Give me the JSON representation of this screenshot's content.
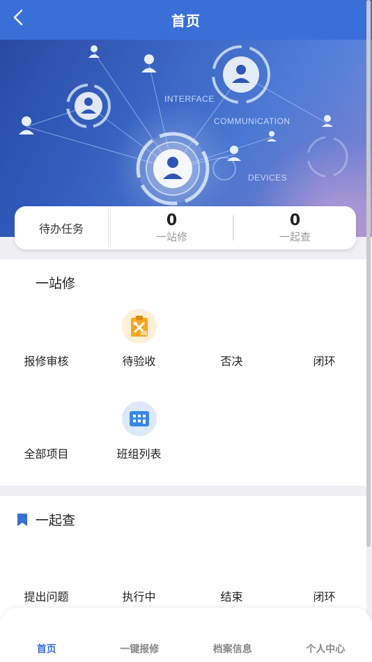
{
  "header": {
    "title": "首页"
  },
  "banner": {
    "text_interface": "INTERFACE",
    "text_communication": "COMMUNICATION",
    "text_devices": "DEVICES"
  },
  "tasks": {
    "label": "待办任务",
    "stats": [
      {
        "value": "0",
        "label": "一站修"
      },
      {
        "value": "0",
        "label": "一起查"
      }
    ]
  },
  "section_repair": {
    "title": "一站修",
    "items": [
      {
        "label": "报修审核"
      },
      {
        "label": "待验收",
        "icon": "clipboard-tools-icon"
      },
      {
        "label": "否决"
      },
      {
        "label": "闭环"
      },
      {
        "label": "全部项目"
      },
      {
        "label": "班组列表",
        "icon": "team-list-icon"
      }
    ]
  },
  "section_check": {
    "title": "一起查",
    "icon": "bookmark-icon",
    "items": [
      {
        "label": "提出问题"
      },
      {
        "label": "执行中"
      },
      {
        "label": "结束"
      },
      {
        "label": "闭环"
      }
    ]
  },
  "tabbar": {
    "tabs": [
      {
        "label": "首页"
      },
      {
        "label": "一键报修"
      },
      {
        "label": "档案信息"
      },
      {
        "label": "个人中心"
      }
    ]
  },
  "colors": {
    "primary": "#3a6fd8",
    "icon_orange": "#f5a623",
    "icon_blue": "#3a86e8"
  }
}
